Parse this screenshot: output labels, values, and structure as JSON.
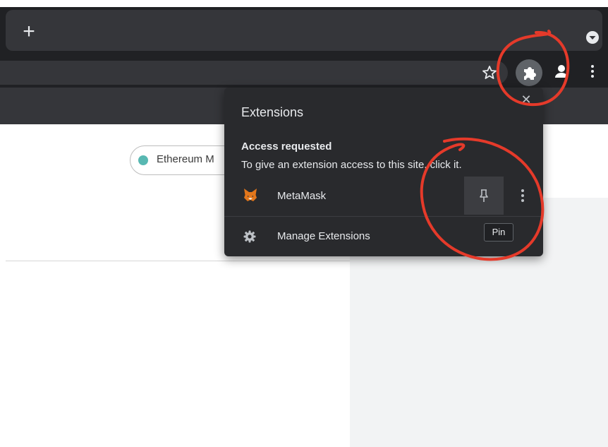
{
  "browser": {
    "new_tab_glyph": "+",
    "icons": {
      "new_tab": "plus-icon",
      "tab_search": "chevron-down-icon",
      "bookmark": "star-icon",
      "extensions": "puzzle-icon",
      "profile": "person-icon",
      "menu": "kebab-icon"
    }
  },
  "page": {
    "network_label": "Ethereum M",
    "network_dot_color": "#58b8b2"
  },
  "extensions_popup": {
    "title": "Extensions",
    "close_glyph": "✕",
    "section_heading": "Access requested",
    "section_description": "To give an extension access to this site, click it.",
    "extension": {
      "name": "MetaMask",
      "icon": "metamask-fox-icon"
    },
    "manage_label": "Manage Extensions",
    "pin_tooltip": "Pin"
  },
  "annotation_color": "#e53a2a"
}
